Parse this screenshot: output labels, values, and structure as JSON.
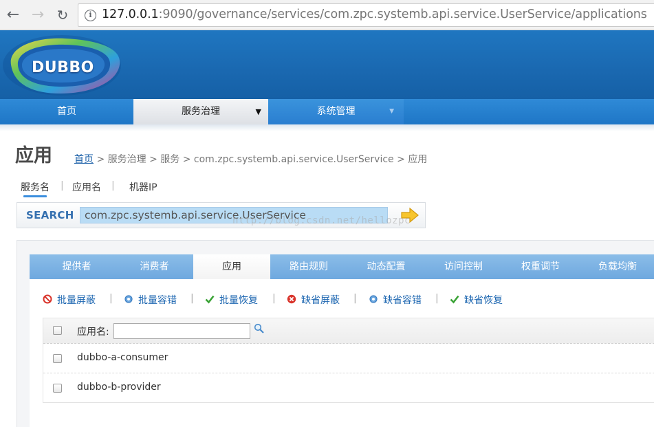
{
  "browser": {
    "url_host": "127.0.0.1",
    "url_rest": ":9090/governance/services/com.zpc.systemb.api.service.UserService/applications",
    "back_icon": "←",
    "forward_icon": "→",
    "reload_icon": "↻",
    "info_icon": "i"
  },
  "header": {
    "logo_text": "DUBBO"
  },
  "mainnav": {
    "items": [
      {
        "label": "首页"
      },
      {
        "label": "服务治理",
        "caret": "▼"
      },
      {
        "label": "系统管理",
        "caret": "▼"
      }
    ]
  },
  "page": {
    "title": "应用",
    "breadcrumb": {
      "home": "首页",
      "sep": ">",
      "governance": "服务治理",
      "services": "服务",
      "service": "com.zpc.systemb.api.service.UserService",
      "current": "应用"
    }
  },
  "search": {
    "tabs": [
      "服务名",
      "应用名",
      "机器IP"
    ],
    "separator": "|",
    "label": "SEARCH",
    "value": "com.zpc.systemb.api.service.UserService",
    "watermark": "http://blog.csdn.net/hellozpc"
  },
  "subtabs": [
    "提供者",
    "消费者",
    "应用",
    "路由规则",
    "动态配置",
    "访问控制",
    "权重调节",
    "负载均衡"
  ],
  "actions": {
    "separator": "|",
    "items": [
      "批量屏蔽",
      "批量容错",
      "批量恢复",
      "缺省屏蔽",
      "缺省容错",
      "缺省恢复"
    ]
  },
  "table": {
    "header_label": "应用名:",
    "rows": [
      "dubbo-a-consumer",
      "dubbo-b-provider"
    ]
  },
  "colors": {
    "header_blue": "#1a68b0",
    "nav_blue": "#2a7ed0",
    "subtab_blue": "#7bb1e3",
    "link_blue": "#1b65b0"
  }
}
